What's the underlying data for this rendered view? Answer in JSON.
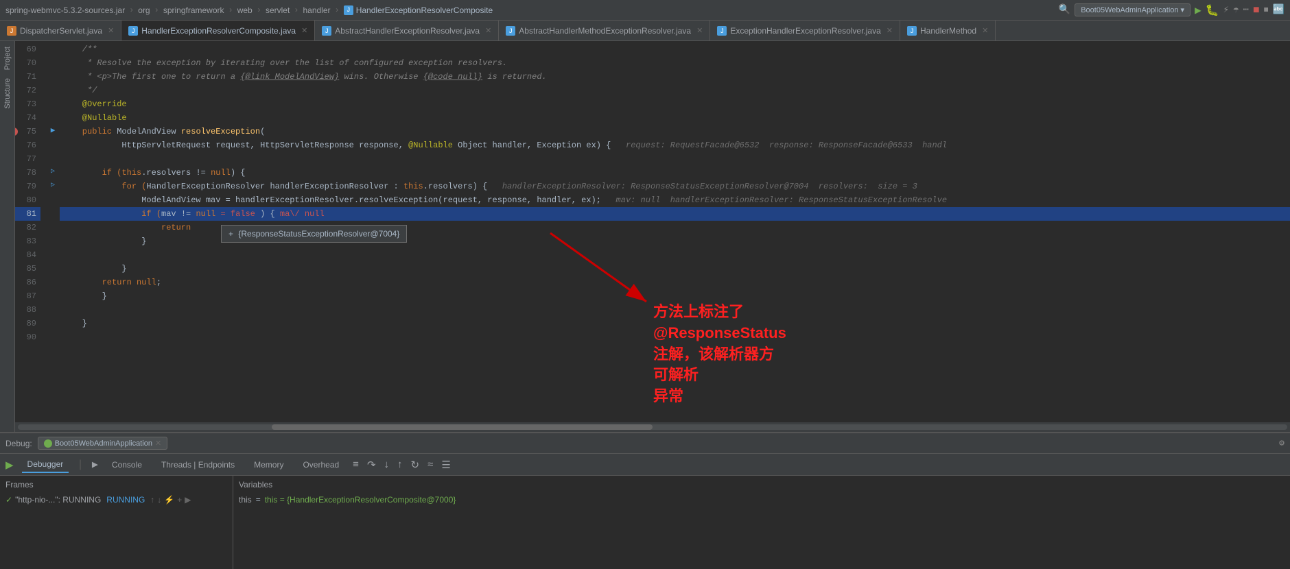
{
  "topbar": {
    "breadcrumbs": [
      "spring-webmvc-5.3.2-sources.jar",
      "org",
      "springframework",
      "web",
      "servlet",
      "handler",
      "HandlerExceptionResolverComposite"
    ],
    "run_config": "Boot05WebAdminApplication",
    "icons": [
      "run",
      "debug",
      "attach",
      "coverage",
      "more",
      "stop",
      "stop2",
      "lang"
    ]
  },
  "tabs": [
    {
      "label": "DispatcherServlet.java",
      "active": false,
      "icon_color": "orange"
    },
    {
      "label": "HandlerExceptionResolverComposite.java",
      "active": true,
      "icon_color": "blue"
    },
    {
      "label": "AbstractHandlerExceptionResolver.java",
      "active": false,
      "icon_color": "blue"
    },
    {
      "label": "AbstractHandlerMethodExceptionResolver.java",
      "active": false,
      "icon_color": "blue"
    },
    {
      "label": "ExceptionHandlerExceptionResolver.java",
      "active": false,
      "icon_color": "blue"
    },
    {
      "label": "HandlerMethod",
      "active": false,
      "icon_color": "blue"
    }
  ],
  "code": {
    "lines": [
      {
        "num": "69",
        "content": "    /**",
        "type": "comment"
      },
      {
        "num": "70",
        "content": "     * Resolve the exception by iterating over the list of configured exception resolvers.",
        "type": "comment"
      },
      {
        "num": "71",
        "content": "     * <p>The first one to return a {@link ModelAndView} wins. Otherwise {@@code null} is returned.",
        "type": "comment"
      },
      {
        "num": "72",
        "content": "     */",
        "type": "comment"
      },
      {
        "num": "73",
        "content": "    @Override",
        "type": "annotation"
      },
      {
        "num": "74",
        "content": "    @Nullable",
        "type": "annotation"
      },
      {
        "num": "75",
        "content": "    public ModelAndView resolveException(",
        "type": "code",
        "debug_arrow": true
      },
      {
        "num": "76",
        "content": "            HttpServletRequest request, HttpServletResponse response, @Nullable Object handler, Exception ex) {",
        "type": "code",
        "hint": "  request: RequestFacade@6532  response: ResponseFacade@6533  handl"
      },
      {
        "num": "77",
        "content": "",
        "type": "empty"
      },
      {
        "num": "78",
        "content": "        if (this.resolvers != null) {",
        "type": "code"
      },
      {
        "num": "79",
        "content": "            for (HandlerExceptionResolver handlerExceptionResolver : this.resolvers) {",
        "type": "code",
        "hint": "  handlerExceptionResolver: ResponseStatusExceptionResolver@7004  resolvers:  size = 3"
      },
      {
        "num": "80",
        "content": "                ModelAndView mav = handlerExceptionResolver.resolveException(request, response, handler, ex);",
        "type": "code",
        "hint": "  mav: null  handlerExceptionResolver: ResponseStatusExceptionResolve"
      },
      {
        "num": "81",
        "content": "                if (mav != null = false ) { ma\\/ null",
        "type": "code",
        "highlighted": true
      },
      {
        "num": "82",
        "content": "                    return",
        "type": "code",
        "highlighted": false,
        "tooltip": true
      },
      {
        "num": "83",
        "content": "                }",
        "type": "code"
      },
      {
        "num": "84",
        "content": "",
        "type": "empty"
      },
      {
        "num": "85",
        "content": "            }",
        "type": "code"
      },
      {
        "num": "86",
        "content": "        return null;",
        "type": "code"
      },
      {
        "num": "87",
        "content": "        }",
        "type": "code"
      },
      {
        "num": "88",
        "content": "",
        "type": "empty"
      },
      {
        "num": "89",
        "content": "    }",
        "type": "code"
      },
      {
        "num": "90",
        "content": "",
        "type": "empty"
      }
    ],
    "tooltip_text": "{ResponseStatusExceptionResolver@7004}",
    "annotation_text": "方法上标注了@ResponseStatus注解，该解析器方可解析\n异常"
  },
  "debug": {
    "title": "Debug:",
    "app_name": "Boot05WebAdminApplication",
    "tabs": [
      "Debugger",
      "Console",
      "Threads | Endpoints",
      "Memory",
      "Overhead"
    ],
    "active_tab": "Debugger",
    "frames_header": "Frames",
    "variables_header": "Variables",
    "frame_item_text": "\"http-nio-...\": RUNNING",
    "variable_this": "this = {HandlerExceptionResolverComposite@7000}"
  }
}
